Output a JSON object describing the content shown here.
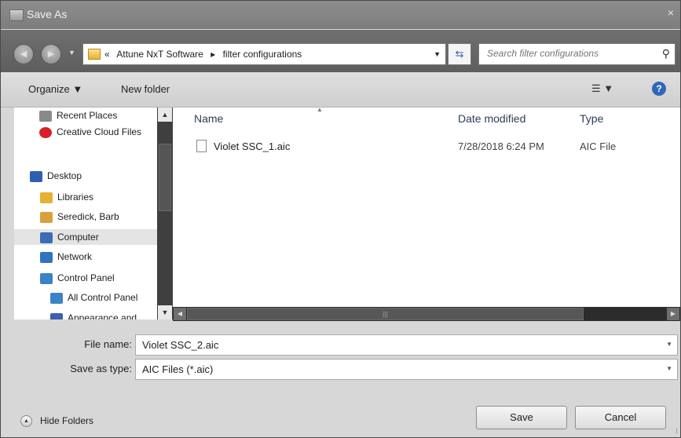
{
  "window": {
    "title": "Save As",
    "close_glyph": "×"
  },
  "nav": {
    "back_glyph": "◀",
    "forward_glyph": "▶",
    "dropdown_glyph": "▼"
  },
  "address": {
    "prefix": "«",
    "crumbs": [
      "Attune NxT Software",
      "filter configurations"
    ],
    "separator": "▸",
    "dropdown_glyph": "▼",
    "refresh_glyph": "⇆"
  },
  "search": {
    "placeholder": "Search filter configurations",
    "icon": "search-icon"
  },
  "toolbar": {
    "organize_label": "Organize ▼",
    "new_folder_label": "New folder",
    "views_glyph": "☰ ▼",
    "help_glyph": "?"
  },
  "sidebar": {
    "items": [
      {
        "label": "Recent Places",
        "icon": "recent-places-icon",
        "color": "#8a8a8a"
      },
      {
        "label": "Creative Cloud Files",
        "icon": "creative-cloud-icon",
        "color": "#da1f26"
      },
      {
        "label": "Desktop",
        "icon": "desktop-icon",
        "color": "#2d5fb0"
      },
      {
        "label": "Libraries",
        "icon": "libraries-icon",
        "color": "#e5b234"
      },
      {
        "label": "Seredick, Barb",
        "icon": "user-folder-icon",
        "color": "#d8a13b"
      },
      {
        "label": "Computer",
        "icon": "computer-icon",
        "color": "#3a6db5",
        "selected": true
      },
      {
        "label": "Network",
        "icon": "network-icon",
        "color": "#2f74c0"
      },
      {
        "label": "Control Panel",
        "icon": "control-panel-icon",
        "color": "#3b83c9"
      },
      {
        "label": "All Control Panel",
        "icon": "control-panel-icon",
        "color": "#3b83c9"
      },
      {
        "label": "Appearance and",
        "icon": "appearance-icon",
        "color": "#3e5fae"
      }
    ]
  },
  "scroll_glyphs": {
    "up": "▲",
    "down": "▼",
    "left": "◀",
    "right": "▶",
    "grip": "⁝"
  },
  "columns": {
    "name": "Name",
    "date": "Date modified",
    "type": "Type",
    "sort_glyph": "▲"
  },
  "files": [
    {
      "name": "Violet SSC_1.aic",
      "date": "7/28/2018 6:24 PM",
      "type": "AIC File"
    }
  ],
  "form": {
    "file_name_label": "File name:",
    "file_name_value": "Violet SSC_2.aic",
    "save_type_label": "Save as type:",
    "save_type_value": "AIC Files (*.aic)",
    "dropdown_glyph": "▼"
  },
  "footer": {
    "hide_folders_label": "Hide Folders",
    "hide_glyph": "▲",
    "save_label": "Save",
    "cancel_label": "Cancel"
  }
}
